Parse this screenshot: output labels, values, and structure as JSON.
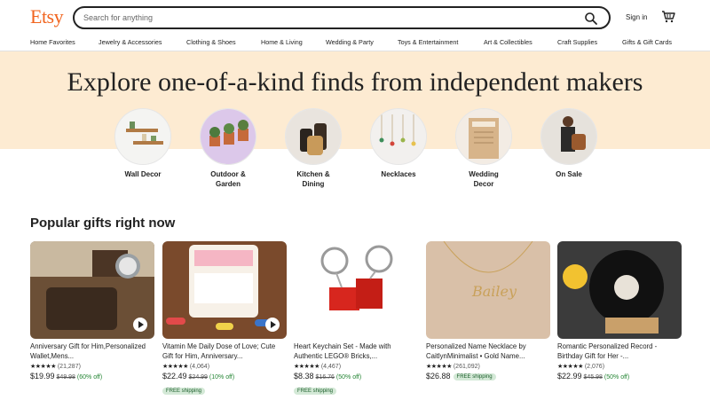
{
  "header": {
    "logo": "Etsy",
    "search_placeholder": "Search for anything",
    "signin_label": "Sign in",
    "cart_icon": "cart-icon",
    "search_icon": "search-icon"
  },
  "nav": [
    "Home Favorites",
    "Jewelry & Accessories",
    "Clothing & Shoes",
    "Home & Living",
    "Wedding & Party",
    "Toys & Entertainment",
    "Art & Collectibles",
    "Craft Supplies",
    "Gifts & Gift Cards"
  ],
  "hero": {
    "title": "Explore one-of-a-kind finds from independent makers"
  },
  "categories": [
    {
      "line1": "Wall Decor",
      "line2": ""
    },
    {
      "line1": "Outdoor &",
      "line2": "Garden"
    },
    {
      "line1": "Kitchen &",
      "line2": "Dining"
    },
    {
      "line1": "Necklaces",
      "line2": ""
    },
    {
      "line1": "Wedding",
      "line2": "Decor"
    },
    {
      "line1": "On Sale",
      "line2": ""
    }
  ],
  "popular": {
    "title": "Popular gifts right now",
    "items": [
      {
        "title": "Anniversary Gift for Him,Personalized Wallet,Mens...",
        "stars": "★★★★★",
        "reviews": "(21,287)",
        "price": "$19.99",
        "old_price": "$49.98",
        "discount": "(60% off)",
        "shipping": ""
      },
      {
        "title": "Vitamin Me Daily Dose of Love; Cute Gift for Him, Anniversary...",
        "stars": "★★★★★",
        "reviews": "(4,064)",
        "price": "$22.49",
        "old_price": "$24.99",
        "discount": "(10% off)",
        "shipping": "FREE shipping"
      },
      {
        "title": "Heart Keychain Set - Made with Authentic LEGO® Bricks,...",
        "stars": "★★★★★",
        "reviews": "(4,467)",
        "price": "$8.38",
        "old_price": "$16.76",
        "discount": "(50% off)",
        "shipping": "FREE shipping"
      },
      {
        "title": "Personalized Name Necklace by CaitlynMinimalist • Gold Name...",
        "stars": "★★★★★",
        "reviews": "(261,092)",
        "price": "$26.88",
        "old_price": "",
        "discount": "",
        "shipping": "FREE shipping"
      },
      {
        "title": "Romantic Personalized Record - Birthday Gift for Her -...",
        "stars": "★★★★★",
        "reviews": "(2,076)",
        "price": "$22.99",
        "old_price": "$45.98",
        "discount": "(50% off)",
        "shipping": ""
      }
    ]
  },
  "colors": {
    "brand": "#F1641E",
    "hero_bg": "#FDEBD2",
    "discount": "#258635",
    "shipping_badge": "#D4E9D7"
  }
}
